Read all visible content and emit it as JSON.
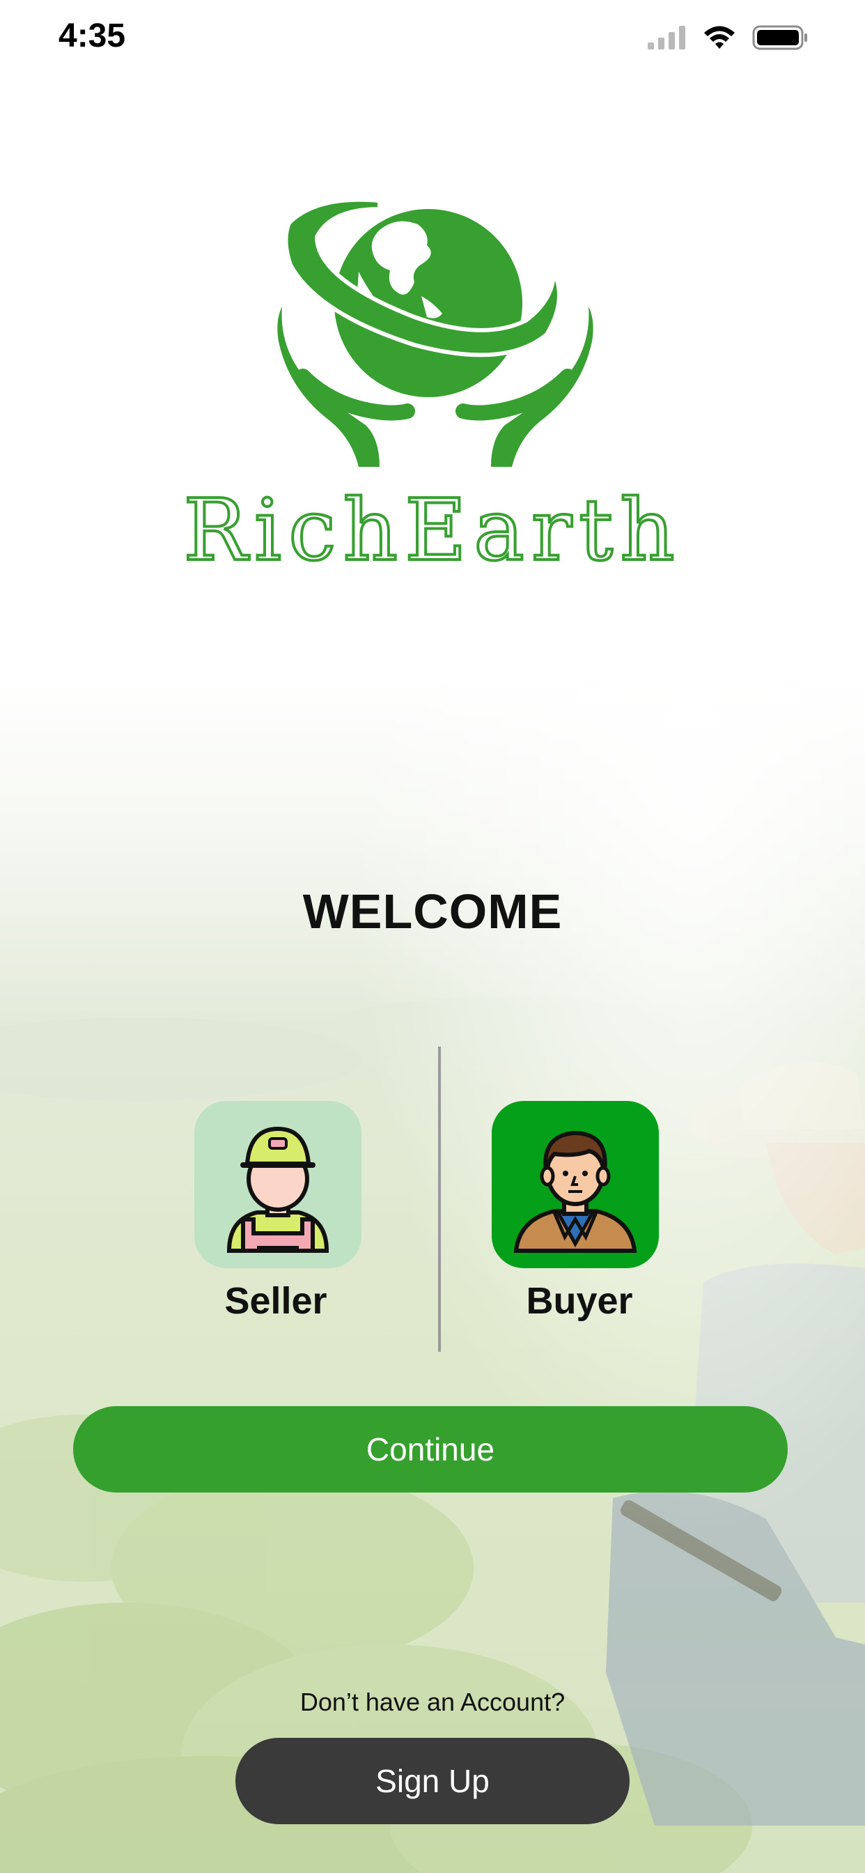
{
  "status_bar": {
    "time": "4:35",
    "icons": [
      "cellular-signal-icon",
      "wifi-icon",
      "battery-icon"
    ]
  },
  "brand": {
    "name": "RichEarth",
    "logo_icon": "globe-in-hands-icon",
    "color": "#37a031"
  },
  "welcome": "WELCOME",
  "roles": [
    {
      "label": "Seller",
      "icon": "farmer-avatar-icon",
      "tile_color": "#bfe2c4"
    },
    {
      "label": "Buyer",
      "icon": "man-avatar-icon",
      "tile_color": "#04a01a"
    }
  ],
  "actions": {
    "continue_label": "Continue",
    "continue_color": "#36a02f",
    "no_account_text": "Don’t have an Account?",
    "signup_label": "Sign Up",
    "signup_color": "#3a3a3a"
  }
}
